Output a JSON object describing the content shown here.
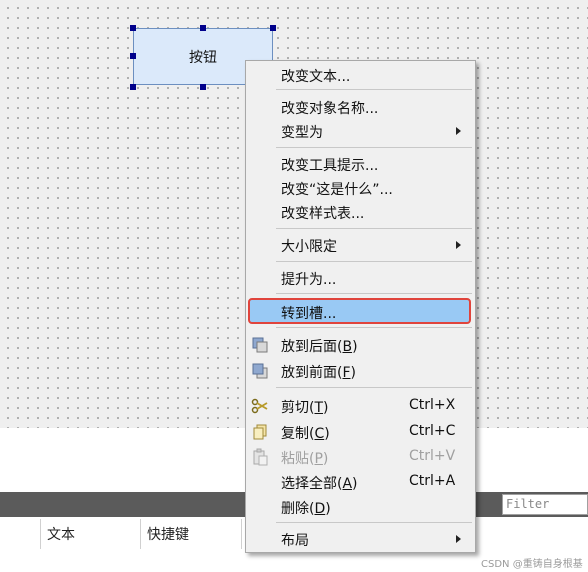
{
  "canvas": {
    "widget_label": "按钮"
  },
  "menu": {
    "items": [
      {
        "label": "改变文本..."
      },
      {
        "label": "改变对象名称..."
      },
      {
        "label": "变型为"
      },
      {
        "label": "改变工具提示..."
      },
      {
        "label": "改变“这是什么”..."
      },
      {
        "label": "改变样式表..."
      },
      {
        "label": "大小限定"
      },
      {
        "label": "提升为..."
      },
      {
        "label": "转到槽..."
      },
      {
        "label_text": "放到后面",
        "mnemonic": "B"
      },
      {
        "label_text": "放到前面",
        "mnemonic": "F"
      },
      {
        "label_text": "剪切",
        "mnemonic": "T",
        "shortcut": "Ctrl+X"
      },
      {
        "label_text": "复制",
        "mnemonic": "C",
        "shortcut": "Ctrl+C"
      },
      {
        "label_text": "粘贴",
        "mnemonic": "P",
        "shortcut": "Ctrl+V",
        "disabled": true
      },
      {
        "label_text": "选择全部",
        "mnemonic": "A",
        "shortcut": "Ctrl+A"
      },
      {
        "label_text": "删除",
        "mnemonic": "D"
      },
      {
        "label": "布局"
      }
    ],
    "highlighted": "转到槽..."
  },
  "lower_panel": {
    "filter_placeholder": "Filter",
    "columns": [
      "文本",
      "快捷键"
    ]
  },
  "watermark": "CSDN @重铸自身根基",
  "colors": {
    "highlight": "#99c9f4",
    "highlight_border": "#e0443c",
    "selection_handle": "#00008b"
  }
}
